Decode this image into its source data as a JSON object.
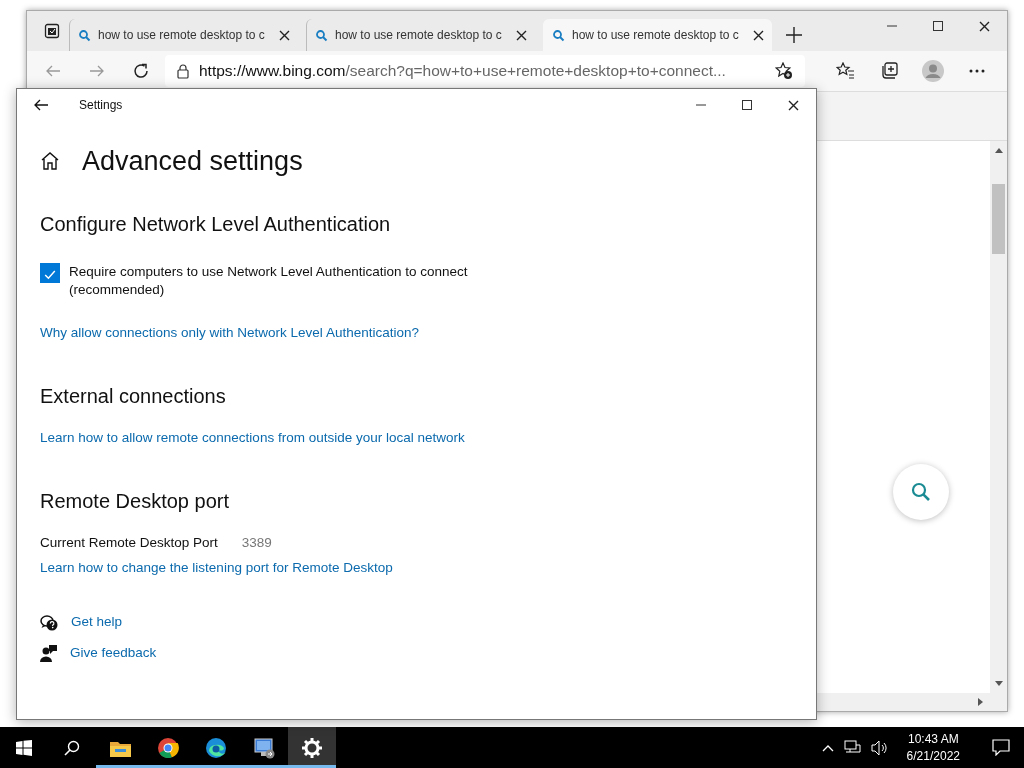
{
  "browser": {
    "tabs": [
      {
        "title": "how to use remote desktop to c",
        "selected": false
      },
      {
        "title": "how to use remote desktop to c",
        "selected": false
      },
      {
        "title": "how to use remote desktop to c",
        "selected": true
      }
    ],
    "address": {
      "host": "https://www.bing.com",
      "path": "/search?q=how+to+use+remote+desktop+to+connect..."
    }
  },
  "settings": {
    "window_title": "Settings",
    "page_title": "Advanced settings",
    "sections": [
      {
        "heading": "Configure Network Level Authentication",
        "items": [
          {
            "kind": "checkbox",
            "label": "Require computers to use Network Level Authentication to connect (recommended)",
            "checked": true
          },
          {
            "kind": "link",
            "text": "Why allow connections only with Network Level Authentication?"
          }
        ]
      },
      {
        "heading": "External connections",
        "items": [
          {
            "kind": "link",
            "text": "Learn how to allow remote connections from outside your local network"
          }
        ]
      },
      {
        "heading": "Remote Desktop port",
        "items": [
          {
            "kind": "field",
            "label": "Current Remote Desktop Port",
            "value": "3389"
          },
          {
            "kind": "link",
            "text": "Learn how to change the listening port for Remote Desktop"
          }
        ]
      }
    ],
    "help_links": [
      {
        "kind": "help",
        "text": "Get help"
      },
      {
        "kind": "feedback",
        "text": "Give feedback"
      }
    ]
  },
  "taskbar": {
    "apps": [
      {
        "kind": "explorer",
        "running": true,
        "selected": false
      },
      {
        "kind": "chrome",
        "running": true,
        "selected": false
      },
      {
        "kind": "edge",
        "running": true,
        "selected": false
      },
      {
        "kind": "remote",
        "running": true,
        "selected": false
      },
      {
        "kind": "settings",
        "running": true,
        "selected": true
      }
    ],
    "time": "10:43 AM",
    "date": "6/21/2022"
  }
}
